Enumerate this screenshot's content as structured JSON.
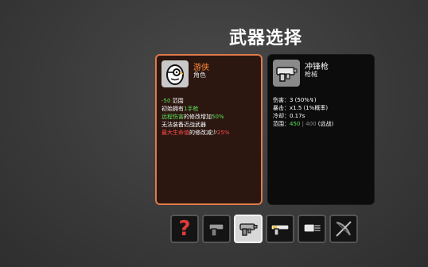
{
  "screen_title": "武器选择",
  "character": {
    "name": "游侠",
    "type": "角色",
    "icon": "egg-monocle-icon",
    "lines": [
      [
        {
          "t": "-50",
          "c": "green"
        },
        {
          "t": " 范围",
          "c": "white"
        }
      ],
      [
        {
          "t": "初始拥有",
          "c": "white"
        },
        {
          "t": "1手枪",
          "c": "green"
        }
      ],
      [
        {
          "t": "远程伤害",
          "c": "green"
        },
        {
          "t": "的修改增加",
          "c": "white"
        },
        {
          "t": "50%",
          "c": "green"
        }
      ],
      [
        {
          "t": "无法装备近战武器",
          "c": "white"
        }
      ],
      [
        {
          "t": "最大生命值",
          "c": "red"
        },
        {
          "t": "的修改减少",
          "c": "white"
        },
        {
          "t": "25%",
          "c": "red"
        }
      ]
    ]
  },
  "weapon": {
    "name": "冲锋枪",
    "type": "枪械",
    "icon": "smg-icon",
    "lines": [
      [
        {
          "t": "伤害：3 (50%",
          "c": "white"
        },
        {
          "t": "↯",
          "c": "white"
        },
        {
          "t": ")",
          "c": "white"
        }
      ],
      [
        {
          "t": "暴击：x1.5 (1%概率)",
          "c": "white"
        }
      ],
      [
        {
          "t": "冷却：0.17s",
          "c": "white"
        }
      ],
      [
        {
          "t": "范围：",
          "c": "white"
        },
        {
          "t": "450",
          "c": "green"
        },
        {
          "t": " | 400",
          "c": "grey"
        },
        {
          "t": " (远战)",
          "c": "white"
        }
      ]
    ]
  },
  "slots": [
    {
      "icon": "random-question-icon",
      "selected": false
    },
    {
      "icon": "pistol-icon",
      "selected": false
    },
    {
      "icon": "smg-icon",
      "selected": true
    },
    {
      "icon": "shotgun-icon",
      "selected": false
    },
    {
      "icon": "minigun-icon",
      "selected": false
    },
    {
      "icon": "crossbow-icon",
      "selected": false
    }
  ]
}
